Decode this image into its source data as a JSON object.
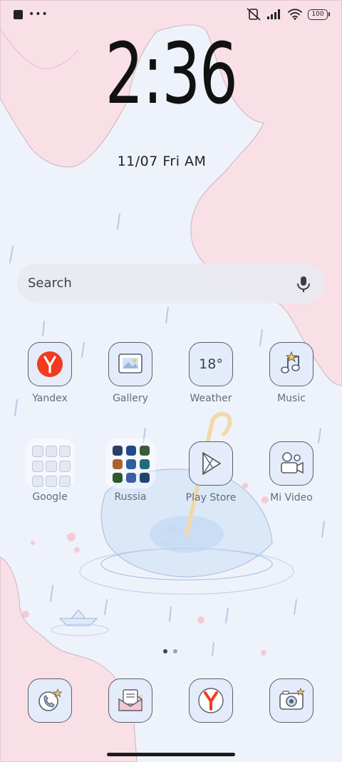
{
  "status_bar": {
    "left_icons": [
      "notification-square-icon",
      "more-dots-icon"
    ],
    "right_icons": [
      "mute-vibrate-icon",
      "signal-icon",
      "wifi-icon"
    ],
    "battery": "100"
  },
  "lockclock": {
    "time": "2:36",
    "date": "11/07 Fri AM"
  },
  "search": {
    "placeholder": "Search",
    "icon": "mic-icon"
  },
  "apps": [
    {
      "label": "Yandex",
      "icon": "yandex-icon"
    },
    {
      "label": "Gallery",
      "icon": "gallery-icon"
    },
    {
      "label": "Weather",
      "icon": "weather-icon",
      "icon_text": "18°"
    },
    {
      "label": "Music",
      "icon": "music-icon"
    },
    {
      "label": "Google",
      "icon": "folder-icon"
    },
    {
      "label": "Russia",
      "icon": "folder-icon"
    },
    {
      "label": "Play Store",
      "icon": "play-store-icon"
    },
    {
      "label": "Mi Video",
      "icon": "mi-video-icon"
    }
  ],
  "dock": [
    {
      "icon": "phone-icon"
    },
    {
      "icon": "messages-icon"
    },
    {
      "icon": "yandex-browser-icon"
    },
    {
      "icon": "camera-icon"
    }
  ],
  "pager": {
    "pages": 2,
    "current": 1
  },
  "colors": {
    "background": "#eef3fb",
    "blossom": "#f9dfe6",
    "icon_fill": "#e4ecfa",
    "yandex_red": "#f23a1e",
    "label": "#656b78"
  }
}
